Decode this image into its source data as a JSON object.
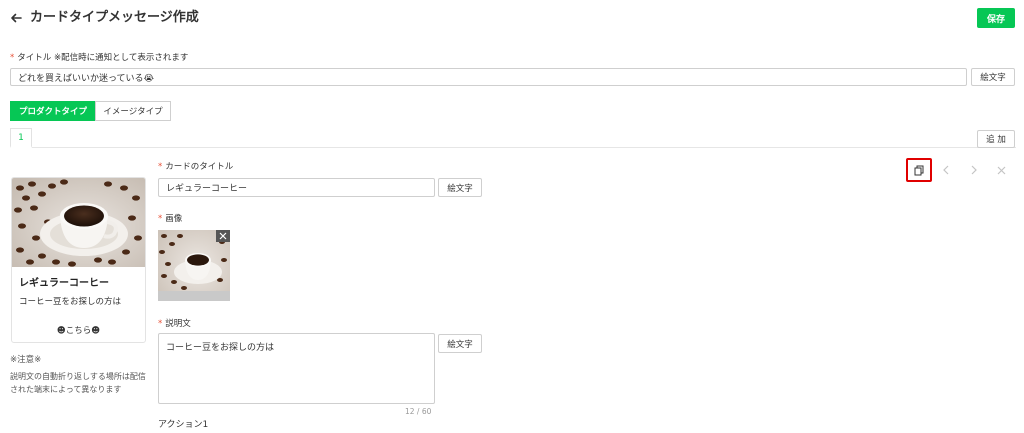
{
  "header": {
    "title": "カードタイプメッセージ作成",
    "save_label": "保存"
  },
  "title_field": {
    "label": "タイトル ※配信時に通知として表示されます",
    "value": "どれを買えばいいか迷っている😭",
    "emoji_button": "絵文字"
  },
  "type_tabs": {
    "product": "プロダクトタイプ",
    "image": "イメージタイプ"
  },
  "card_tabs": {
    "current": "1",
    "add_label": "追 加"
  },
  "preview": {
    "title": "レギュラーコーヒー",
    "description": "コーヒー豆をお探しの方は",
    "action": "☻こちら☻"
  },
  "note": {
    "title": "※注意※",
    "body": "説明文の自動折り返しする場所は配信された端末によって異なります"
  },
  "card_form": {
    "card_title_label": "カードのタイトル",
    "card_title_value": "レギュラーコーヒー",
    "card_title_emoji": "絵文字",
    "image_label": "画像",
    "description_label": "説明文",
    "description_value": "コーヒー豆をお探しの方は",
    "description_emoji": "絵文字",
    "char_count": "12 / 60",
    "action_label": "アクション1"
  },
  "colors": {
    "accent": "#06c755",
    "required": "#e8533a",
    "highlight": "#e00000"
  }
}
